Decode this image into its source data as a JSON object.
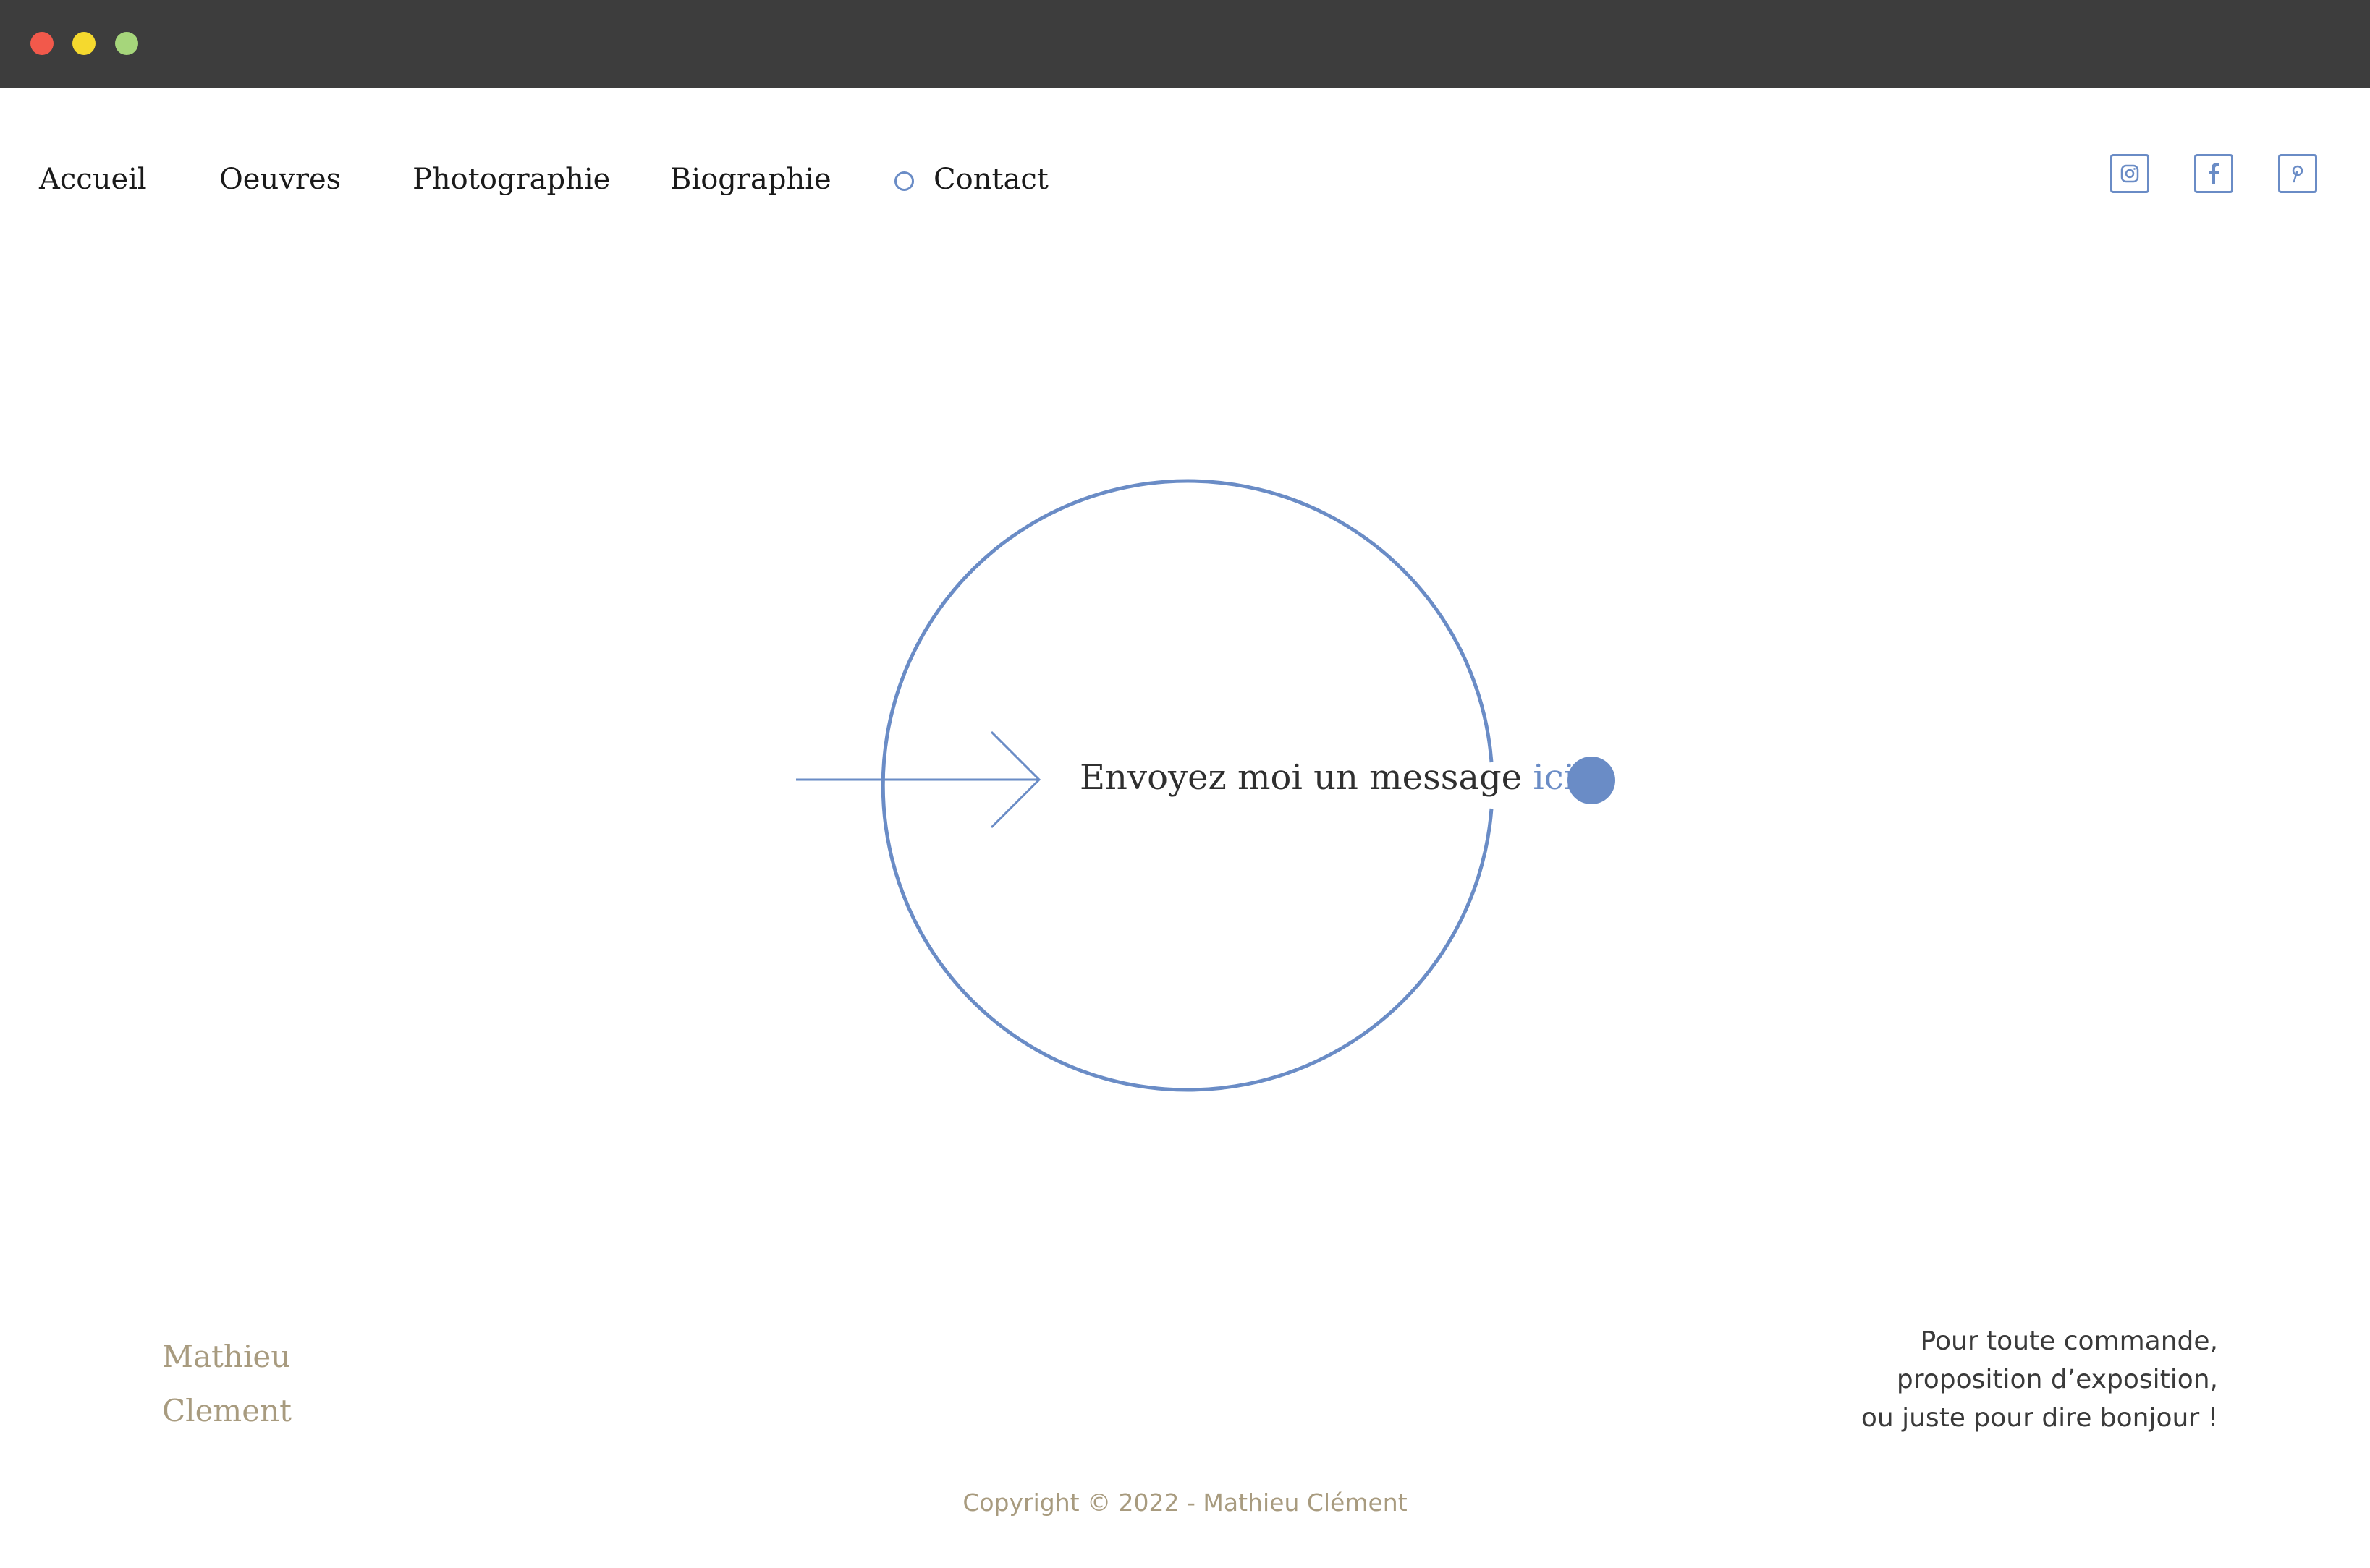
{
  "nav": {
    "items": [
      {
        "label": "Accueil"
      },
      {
        "label": "Oeuvres"
      },
      {
        "label": "Photographie"
      },
      {
        "label": "Biographie"
      },
      {
        "label": "Contact",
        "active": true
      }
    ]
  },
  "social": [
    {
      "icon": "instagram-icon"
    },
    {
      "icon": "facebook-icon"
    },
    {
      "icon": "pinterest-icon"
    }
  ],
  "hero": {
    "message": "Envoyez moi un message",
    "link_label": "ici"
  },
  "footer": {
    "brand_first": "Mathieu",
    "brand_last": "Clement",
    "message_lines": [
      "Pour toute commande,",
      "proposition d’exposition,",
      "ou juste pour dire bonjour !"
    ],
    "copyright": "Copyright © 2022 - Mathieu Clément"
  },
  "colors": {
    "accent": "#6a8cc6",
    "brand": "#a89b7f",
    "titlebar": "#3d3d3d",
    "text": "#1a1a1a"
  }
}
